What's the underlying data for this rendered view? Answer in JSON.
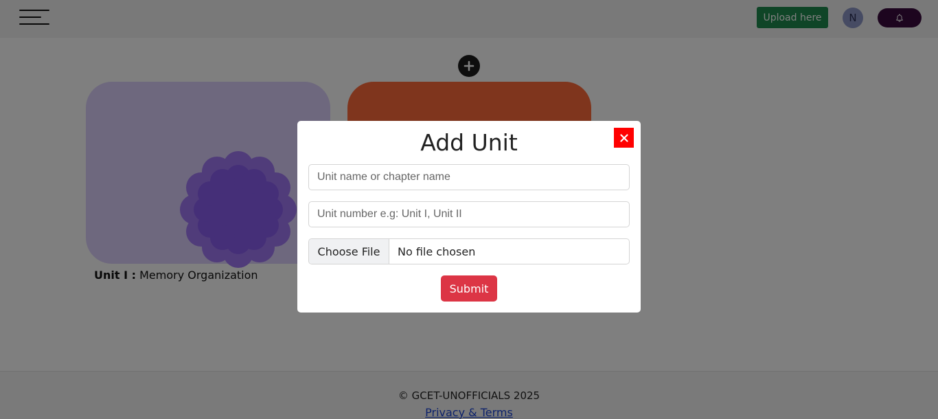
{
  "header": {
    "upload_label": "Upload here",
    "avatar_initial": "N",
    "icons": {
      "menu": "hamburger-icon",
      "notifications": "bell-icon"
    },
    "colors": {
      "upload": "#1e8a4e",
      "bell_button": "#3a0b3e",
      "avatar": "#8d96c6"
    }
  },
  "main": {
    "add_icon": "plus-icon",
    "cards": [
      {
        "prefix": "Unit I :",
        "name": "Memory Organization",
        "color": "#dcd1fd"
      },
      {
        "color": "#ff6b3a"
      }
    ]
  },
  "modal": {
    "title": "Add Unit",
    "close_icon": "close-icon",
    "unit_name_placeholder": "Unit name or chapter name",
    "unit_number_placeholder": "Unit number e.g: Unit I, Unit II",
    "file_button_label": "Choose File",
    "file_status": "No file chosen",
    "submit_label": "Submit",
    "colors": {
      "close": "#ff0000",
      "submit": "#dc3545"
    }
  },
  "footer": {
    "copyright": "© GCET-UNOFFICIALS 2025",
    "privacy_link": "Privacy & Terms"
  }
}
